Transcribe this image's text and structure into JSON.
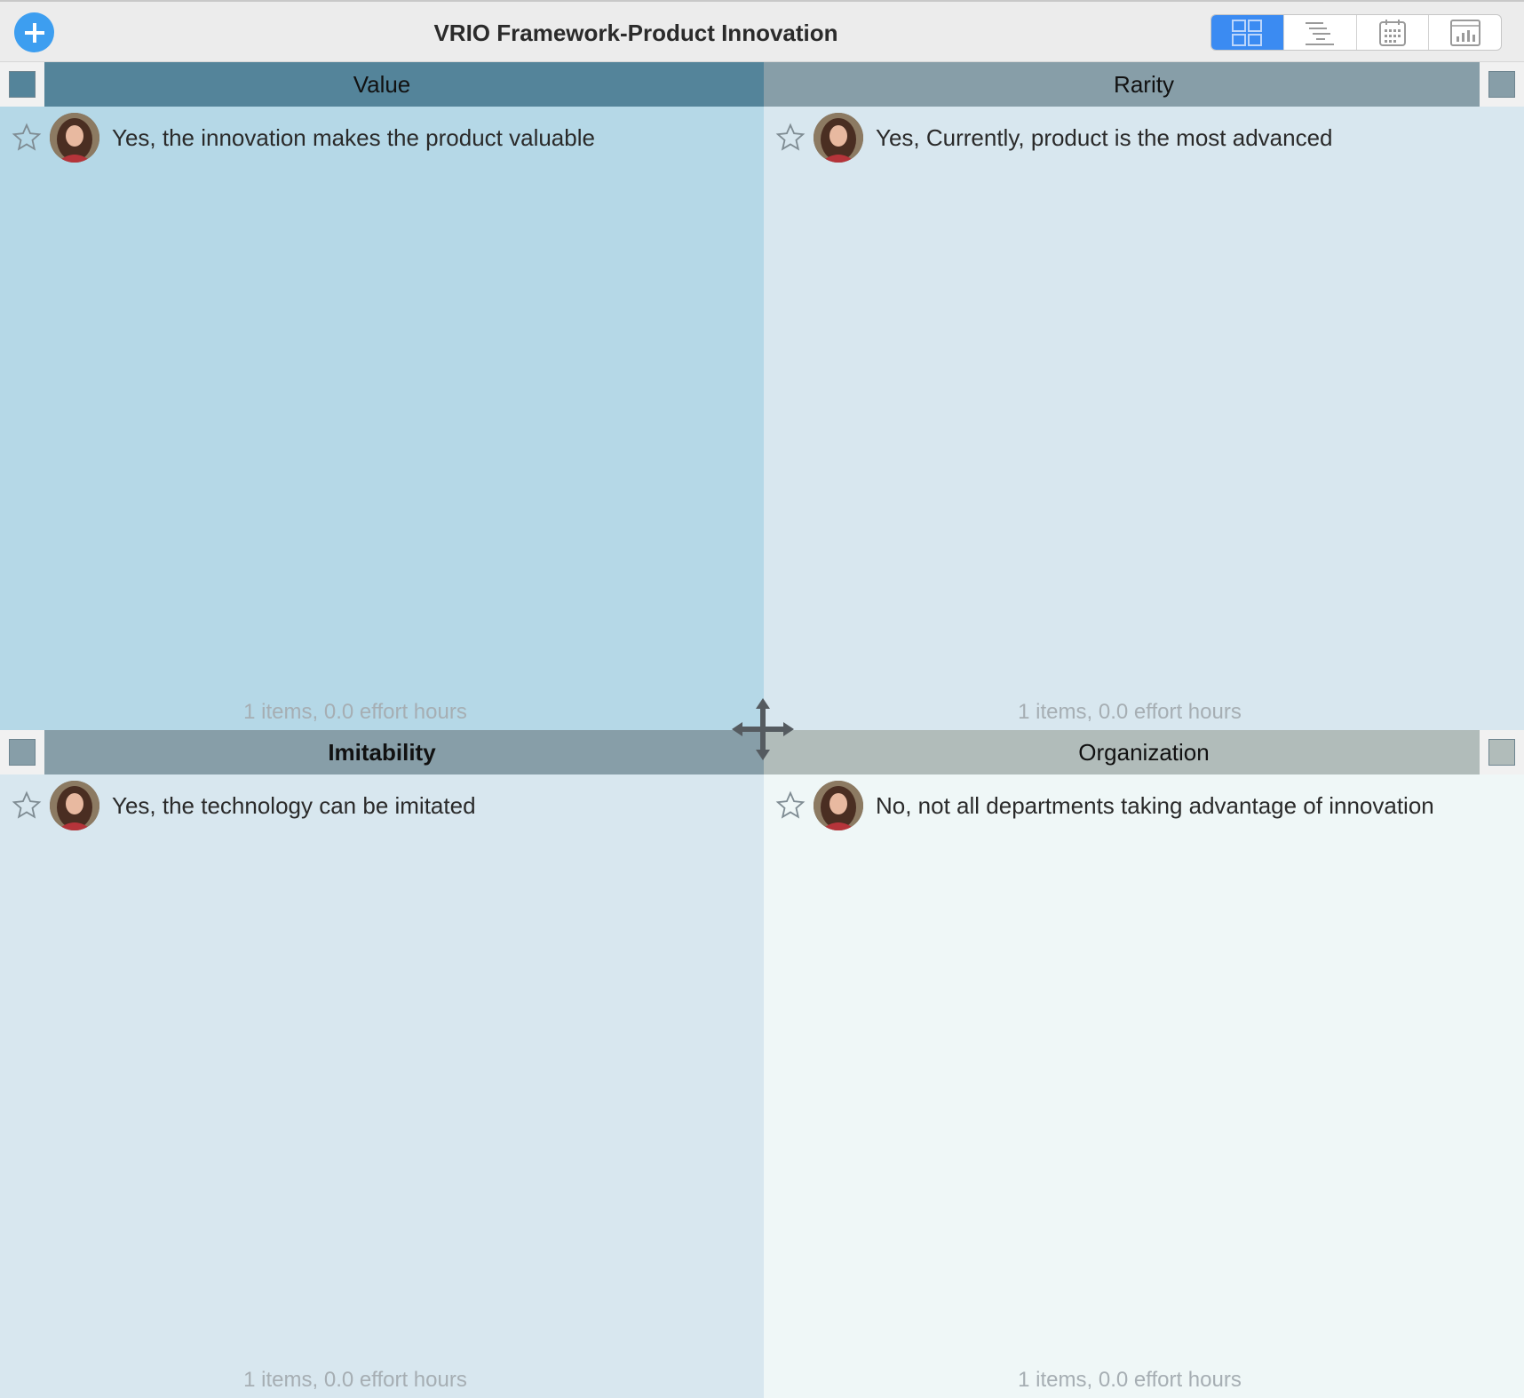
{
  "window": {
    "title": "VRIO Framework-Product Innovation",
    "add_icon": "plus-circle-icon",
    "view_switcher": [
      {
        "name": "matrix-view",
        "icon": "grid-icon",
        "active": true
      },
      {
        "name": "outline-view",
        "icon": "outline-list-icon",
        "active": false
      },
      {
        "name": "calendar-view",
        "icon": "calendar-icon",
        "active": false
      },
      {
        "name": "report-view",
        "icon": "bar-chart-icon",
        "active": false
      }
    ]
  },
  "quadrants": {
    "value": {
      "label": "Value",
      "header_color": "#54849a",
      "items": [
        {
          "text": "Yes, the innovation makes the product valuable",
          "starred": false
        }
      ],
      "footer": "1 items, 0.0 effort hours"
    },
    "rarity": {
      "label": "Rarity",
      "header_color": "#879ea8",
      "items": [
        {
          "text": "Yes, Currently, product is the most advanced",
          "starred": false
        }
      ],
      "footer": "1 items, 0.0 effort hours"
    },
    "imitability": {
      "label": "Imitability",
      "header_color": "#879ea8",
      "items": [
        {
          "text": "Yes, the technology can be imitated",
          "starred": false
        }
      ],
      "footer": "1 items, 0.0 effort hours"
    },
    "organization": {
      "label": "Organization",
      "header_color": "#b1bcba",
      "items": [
        {
          "text": "No, not all departments taking advantage of innovation",
          "starred": false
        }
      ],
      "footer": "1 items, 0.0 effort hours"
    }
  },
  "colors": {
    "accent": "#3b8bf2",
    "value_bg": "#b5d8e7",
    "rarity_bg": "#d8e7ef",
    "imitability_bg": "#d8e7ef",
    "organization_bg": "#eff7f7"
  }
}
